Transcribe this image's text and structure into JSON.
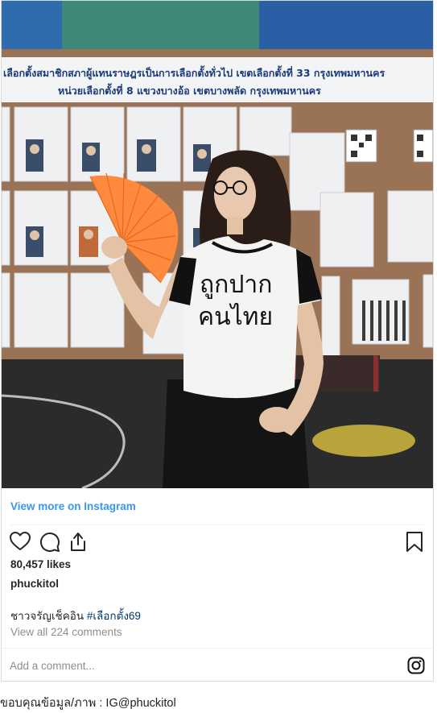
{
  "photo": {
    "banner_line1": "เลือกตั้งสมาชิกสภาผู้แทนราษฎรเป็นการเลือกตั้งทั่วไป เขตเลือกตั้งที่ 33 กรุงเทพมหานคร",
    "banner_line2": "หน่วยเลือกตั้งที่ 8 แขวงบางอ้อ เขตบางพลัด กรุงเทพมหานคร",
    "shirt_line1": "ถูกปาก",
    "shirt_line2": "คนไทย"
  },
  "embed": {
    "view_more": "View more on Instagram",
    "likes": "80,457 likes",
    "username": "phuckitol",
    "caption_text": "ชาวจรัญเช็คอิน ",
    "caption_hashtag": "#เลือกตั้ง69",
    "view_all_comments": "View all 224 comments",
    "comment_placeholder": "Add a comment...",
    "icons": [
      "heart-icon",
      "comment-icon",
      "share-icon",
      "bookmark-icon",
      "instagram-icon"
    ]
  },
  "credit": "ขอบคุณข้อมูล/ภาพ : IG@phuckitol",
  "colors": {
    "link_blue": "#3897f0",
    "hashtag": "#00376b",
    "muted": "#8e8e8e",
    "fan_orange": "#ff8a3d"
  }
}
